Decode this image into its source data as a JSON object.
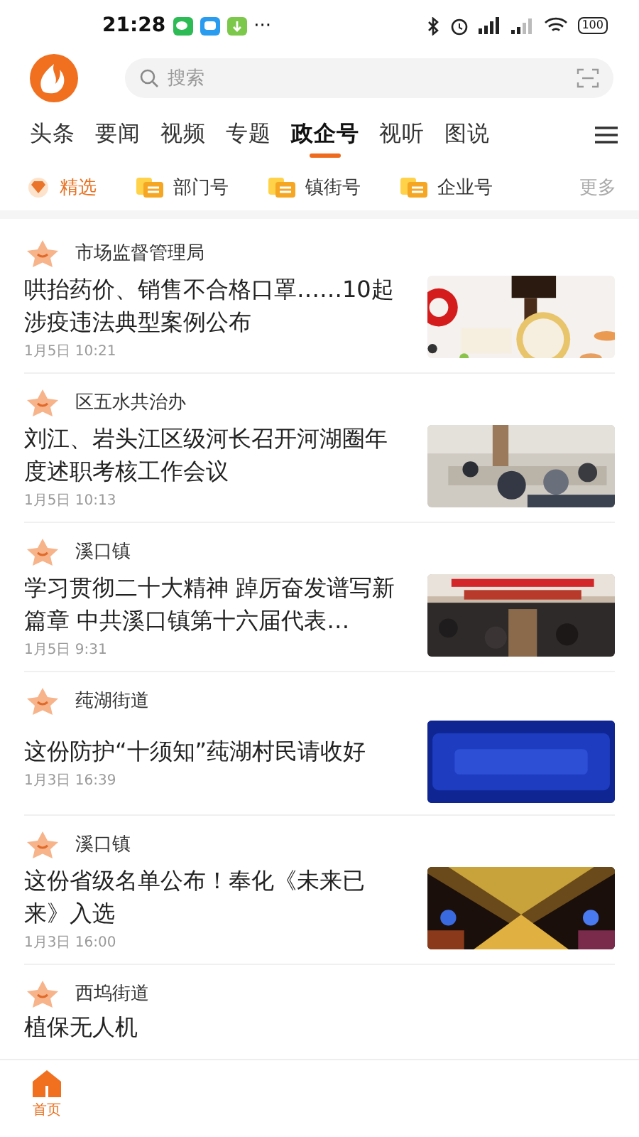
{
  "status_bar": {
    "time": "21:28",
    "more": "···",
    "battery": "100"
  },
  "search": {
    "placeholder": "搜索"
  },
  "channels": [
    {
      "label": "头条",
      "selected": false
    },
    {
      "label": "要闻",
      "selected": false
    },
    {
      "label": "视频",
      "selected": false
    },
    {
      "label": "专题",
      "selected": false
    },
    {
      "label": "政企号",
      "selected": true
    },
    {
      "label": "视听",
      "selected": false
    },
    {
      "label": "图说",
      "selected": false
    }
  ],
  "sub_tabs": [
    {
      "label": "精选",
      "kind": "featured",
      "selected": true
    },
    {
      "label": "部门号",
      "kind": "account",
      "selected": false
    },
    {
      "label": "镇街号",
      "kind": "account",
      "selected": false
    },
    {
      "label": "企业号",
      "kind": "account",
      "selected": false
    }
  ],
  "sub_tabs_more": "更多",
  "articles": [
    {
      "source": "市场监督管理局",
      "title": "哄抬药价、销售不合格口罩……10起涉疫违法典型案例公布",
      "date": "1月5日 10:21"
    },
    {
      "source": "区五水共治办",
      "title": "刘江、岩头江区级河长召开河湖圈年度述职考核工作会议",
      "date": "1月5日 10:13"
    },
    {
      "source": "溪口镇",
      "title": "学习贯彻二十大精神 踔厉奋发谱写新篇章 中共溪口镇第十六届代表…",
      "date": "1月5日 9:31"
    },
    {
      "source": "莼湖街道",
      "title": "这份防护“十须知”莼湖村民请收好",
      "date": "1月3日 16:39"
    },
    {
      "source": "溪口镇",
      "title": "这份省级名单公布！奉化《未来已来》入选",
      "date": "1月3日 16:00"
    },
    {
      "source": "西坞街道",
      "title": "植保无人机"
    }
  ],
  "bottom_nav": [
    {
      "label": "首页",
      "selected": true
    }
  ]
}
